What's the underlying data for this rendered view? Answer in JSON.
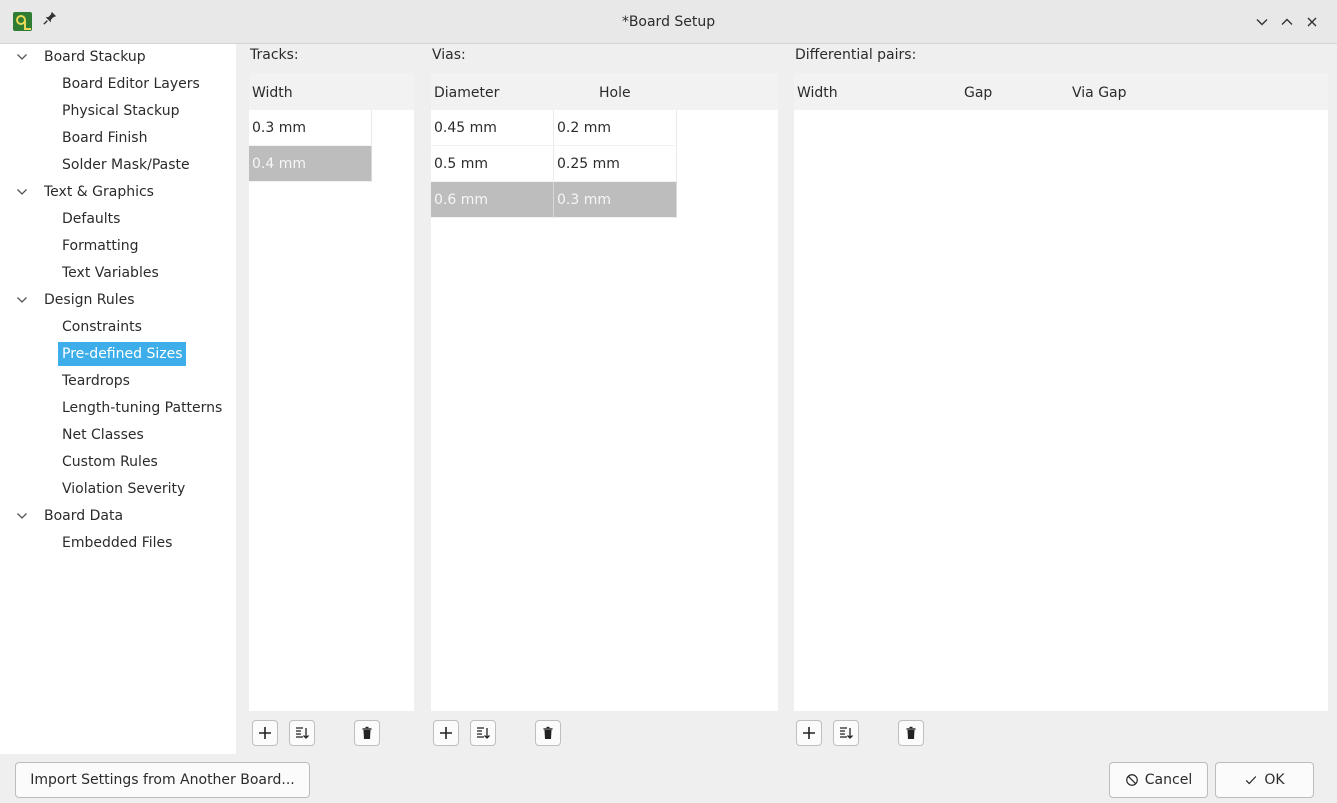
{
  "window": {
    "title": "*Board Setup"
  },
  "sidebar": {
    "items": [
      {
        "label": "Board Stackup",
        "level": 0,
        "expanded": true
      },
      {
        "label": "Board Editor Layers",
        "level": 1
      },
      {
        "label": "Physical Stackup",
        "level": 1
      },
      {
        "label": "Board Finish",
        "level": 1
      },
      {
        "label": "Solder Mask/Paste",
        "level": 1
      },
      {
        "label": "Text & Graphics",
        "level": 0,
        "expanded": true
      },
      {
        "label": "Defaults",
        "level": 1
      },
      {
        "label": "Formatting",
        "level": 1
      },
      {
        "label": "Text Variables",
        "level": 1
      },
      {
        "label": "Design Rules",
        "level": 0,
        "expanded": true
      },
      {
        "label": "Constraints",
        "level": 1
      },
      {
        "label": "Pre-defined Sizes",
        "level": 1,
        "selected": true
      },
      {
        "label": "Teardrops",
        "level": 1
      },
      {
        "label": "Length-tuning Patterns",
        "level": 1
      },
      {
        "label": "Net Classes",
        "level": 1
      },
      {
        "label": "Custom Rules",
        "level": 1
      },
      {
        "label": "Violation Severity",
        "level": 1
      },
      {
        "label": "Board Data",
        "level": 0,
        "expanded": true
      },
      {
        "label": "Embedded Files",
        "level": 1
      }
    ]
  },
  "tracks": {
    "label": "Tracks:",
    "columns": [
      "Width"
    ],
    "rows": [
      [
        "0.3 mm"
      ],
      [
        "0.4 mm"
      ]
    ],
    "selected_row": 1
  },
  "vias": {
    "label": "Vias:",
    "columns": [
      "Diameter",
      "Hole"
    ],
    "rows": [
      [
        "0.45 mm",
        "0.2 mm"
      ],
      [
        "0.5 mm",
        "0.25 mm"
      ],
      [
        "0.6 mm",
        "0.3 mm"
      ]
    ],
    "selected_row": 2
  },
  "diff_pairs": {
    "label": "Differential pairs:",
    "columns": [
      "Width",
      "Gap",
      "Via Gap"
    ],
    "rows": []
  },
  "footer": {
    "import_label": "Import Settings from Another Board...",
    "cancel_label": "Cancel",
    "ok_label": "OK"
  },
  "colors": {
    "selection_accent": "#3daee9",
    "row_selected": "#bdbdbd"
  }
}
